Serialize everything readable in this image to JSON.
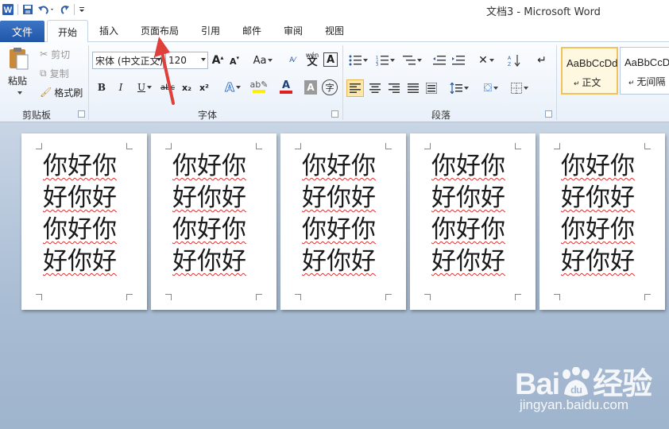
{
  "window": {
    "title": "文档3 - Microsoft Word",
    "app_icon": "W"
  },
  "tabs": {
    "file": "文件",
    "home": "开始",
    "insert": "插入",
    "page_layout": "页面布局",
    "references": "引用",
    "mailings": "邮件",
    "review": "审阅",
    "view": "视图"
  },
  "clipboard": {
    "paste": "粘贴",
    "cut": "剪切",
    "copy": "复制",
    "format_painter": "格式刷",
    "group_label": "剪贴板"
  },
  "font": {
    "family": "宋体 (中文正文)",
    "size": "120",
    "grow": "A",
    "shrink": "A",
    "change_case": "Aa",
    "bold": "B",
    "italic": "I",
    "underline": "U",
    "strike": "abc",
    "subscript": "x₂",
    "superscript": "x²",
    "phonetic": "wén",
    "char_border": "A",
    "char_shading": "A",
    "enclose": "字",
    "group_label": "字体"
  },
  "paragraph": {
    "group_label": "段落"
  },
  "styles": {
    "items": [
      {
        "preview": "AaBbCcDd",
        "name": "正文"
      },
      {
        "preview": "AaBbCcDd",
        "name": "无间隔"
      }
    ]
  },
  "document": {
    "pages": [
      {
        "lines": [
          "你好你",
          "好你好",
          "你好你",
          "好你好"
        ]
      },
      {
        "lines": [
          "你好你",
          "好你好",
          "你好你",
          "好你好"
        ]
      },
      {
        "lines": [
          "你好你",
          "好你好",
          "你好你",
          "好你好"
        ]
      },
      {
        "lines": [
          "你好你",
          "好你好",
          "你好你",
          "好你好"
        ]
      },
      {
        "lines": [
          "你好你",
          "好你好",
          "你好你",
          "好你好"
        ]
      }
    ]
  },
  "watermark": {
    "logo": "Baidu经验",
    "url": "jingyan.baidu.com"
  },
  "colors": {
    "file_tab": "#2a64b8",
    "spell_underline": "#e03030",
    "arrow": "#e0403a",
    "font_color_bar": "#e02020",
    "highlight_bar": "#ffee00"
  }
}
